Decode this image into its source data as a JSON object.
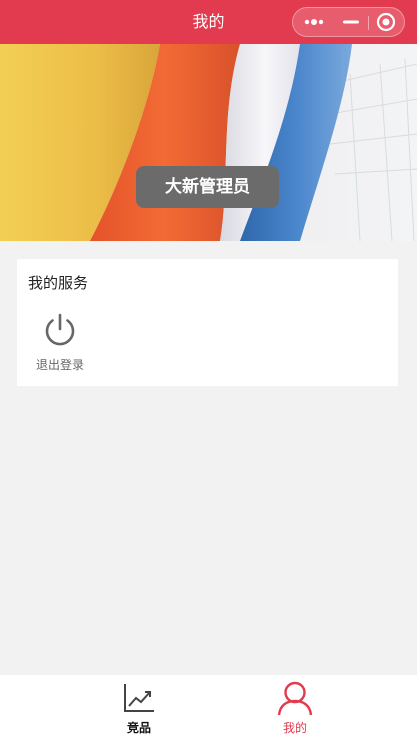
{
  "nav": {
    "title": "我的",
    "capsule_icons": [
      "more-dots-icon",
      "minimize-icon",
      "close-target-icon"
    ]
  },
  "banner": {
    "username": "大新管理员"
  },
  "services": {
    "title": "我的服务",
    "items": [
      {
        "label": "退出登录",
        "icon": "power-icon"
      }
    ]
  },
  "tabbar": {
    "items": [
      {
        "label": "竞品",
        "icon": "trend-chart-icon",
        "active": false
      },
      {
        "label": "我的",
        "icon": "user-icon",
        "active": true
      }
    ]
  },
  "colors": {
    "brand": "#e23a4e",
    "background": "#f2f2f2",
    "card": "#ffffff",
    "username_pill": "#6b6b6b",
    "icon_gray": "#666666"
  }
}
